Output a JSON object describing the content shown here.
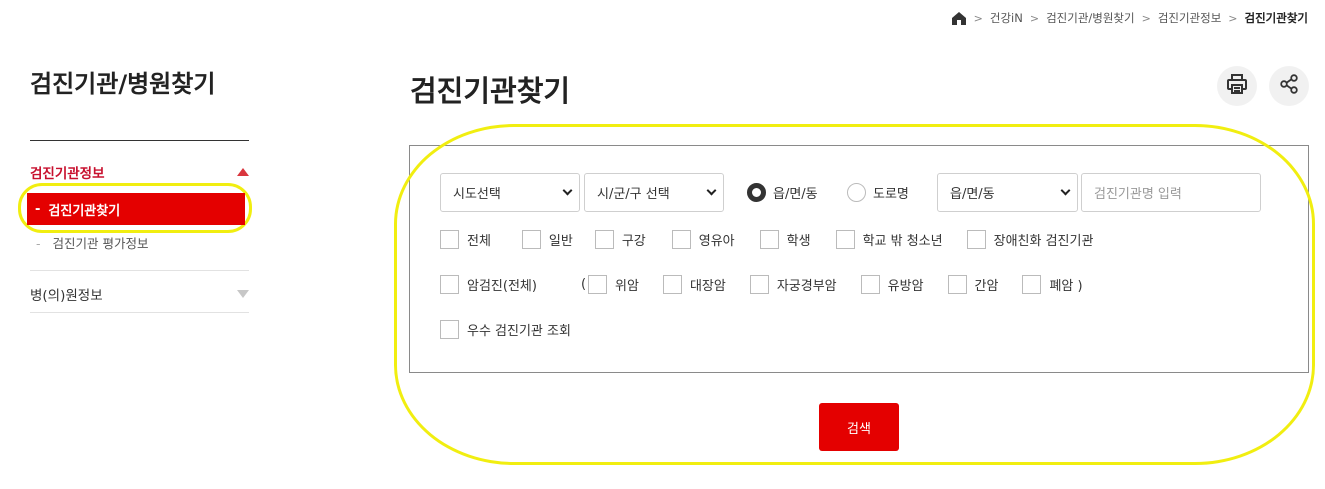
{
  "breadcrumb": {
    "items": [
      "건강iN",
      "검진기관/병원찾기",
      "검진기관정보"
    ],
    "current": "검진기관찾기"
  },
  "sidebar": {
    "title": "검진기관/병원찾기",
    "section1": {
      "label": "검진기관정보"
    },
    "active": {
      "dash": "-",
      "label": "검진기관찾기"
    },
    "sub": {
      "dash": "-",
      "label": "검진기관 평가정보"
    },
    "section2": {
      "label": "병(의)원정보"
    }
  },
  "main": {
    "title": "검진기관찾기",
    "filters": {
      "sido": "시도선택",
      "sigungu": "시/군/구 선택",
      "radio_1": "읍/면/동",
      "radio_2": "도로명",
      "eup": "읍/면/동",
      "name_placeholder": "검진기관명 입력"
    },
    "checkbox_row1": [
      "전체",
      "일반",
      "구강",
      "영유아",
      "학생",
      "학교 밖 청소년",
      "장애친화 검진기관"
    ],
    "checkbox_row2": {
      "cancer_all": "암검진(전체)",
      "open_paren": "(",
      "items": [
        "위암",
        "대장암",
        "자궁경부암",
        "유방암",
        "간암",
        "폐암 )"
      ]
    },
    "checkbox_row3": [
      "우수 검진기관 조회"
    ],
    "search_label": "검색"
  },
  "colors": {
    "brand_red": "#e40000",
    "highlight_yellow": "#f1ee10"
  }
}
